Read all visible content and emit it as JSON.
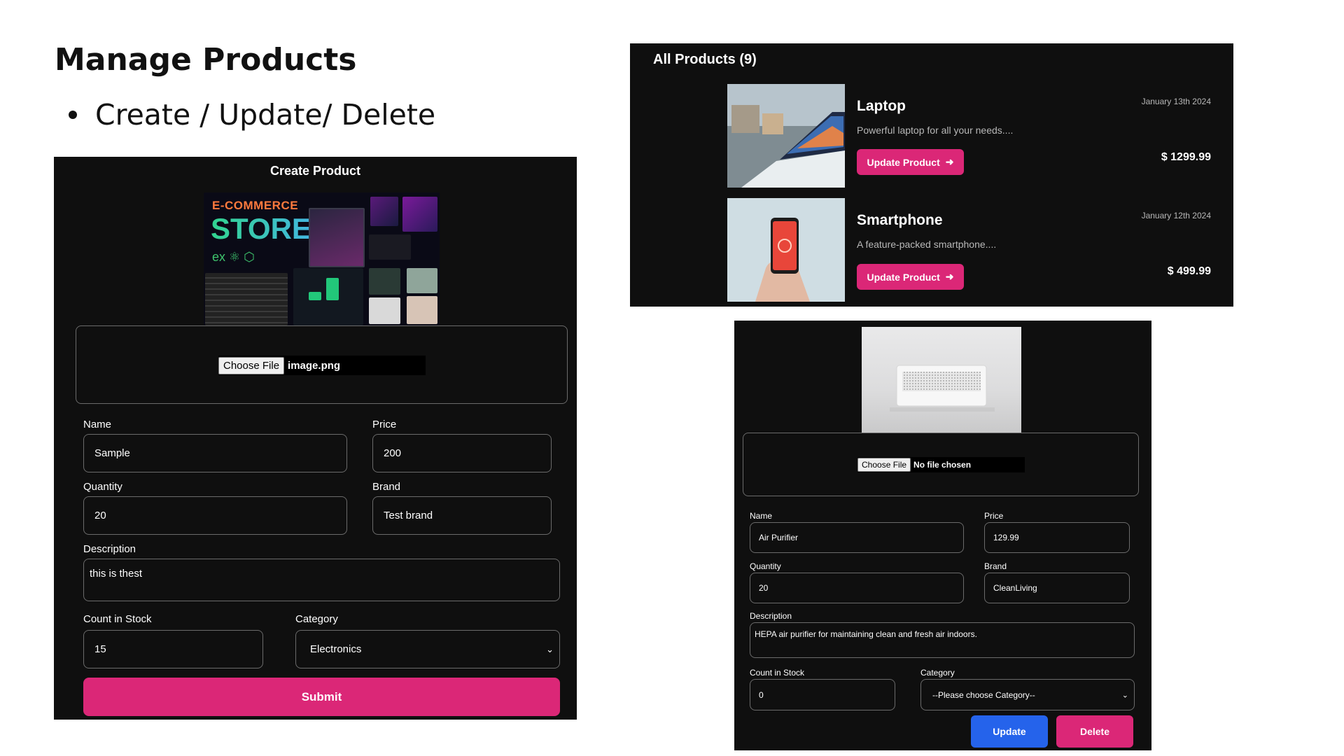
{
  "slide": {
    "title": "Manage Products",
    "bullets": [
      "Create / Update/ Delete"
    ]
  },
  "create_form": {
    "title": "Create Product",
    "banner": {
      "line1": "E-COMMERCE",
      "line2": "STORE",
      "tech": "ex ⚛ ⬡"
    },
    "file_button": "Choose File",
    "file_name": "image.png",
    "name_label": "Name",
    "name_value": "Sample",
    "price_label": "Price",
    "price_value": "200",
    "quantity_label": "Quantity",
    "quantity_value": "20",
    "brand_label": "Brand",
    "brand_value": "Test brand",
    "description_label": "Description",
    "description_value": "this is thest",
    "stock_label": "Count in Stock",
    "stock_value": "15",
    "category_label": "Category",
    "category_value": "Electronics",
    "submit_label": "Submit",
    "colors": {
      "accent": "#db2777",
      "panel": "#0f0f0f"
    }
  },
  "product_list": {
    "title": "All Products (9)",
    "update_label": "Update Product",
    "items": [
      {
        "name": "Laptop",
        "description": "Powerful laptop for all your needs....",
        "date": "January 13th 2024",
        "price": "$ 1299.99"
      },
      {
        "name": "Smartphone",
        "description": "A feature-packed smartphone....",
        "date": "January 12th 2024",
        "price": "$ 499.99"
      }
    ]
  },
  "update_form": {
    "file_button": "Choose File",
    "file_name": "No file chosen",
    "name_label": "Name",
    "name_value": "Air Purifier",
    "price_label": "Price",
    "price_value": "129.99",
    "quantity_label": "Quantity",
    "quantity_value": "20",
    "brand_label": "Brand",
    "brand_value": "CleanLiving",
    "description_label": "Description",
    "description_value": "HEPA air purifier for maintaining clean and fresh air indoors.",
    "stock_label": "Count in Stock",
    "stock_value": "0",
    "category_label": "Category",
    "category_value": "--Please choose Category--",
    "update_label": "Update",
    "delete_label": "Delete",
    "colors": {
      "update": "#2563eb",
      "delete": "#db2777"
    }
  }
}
